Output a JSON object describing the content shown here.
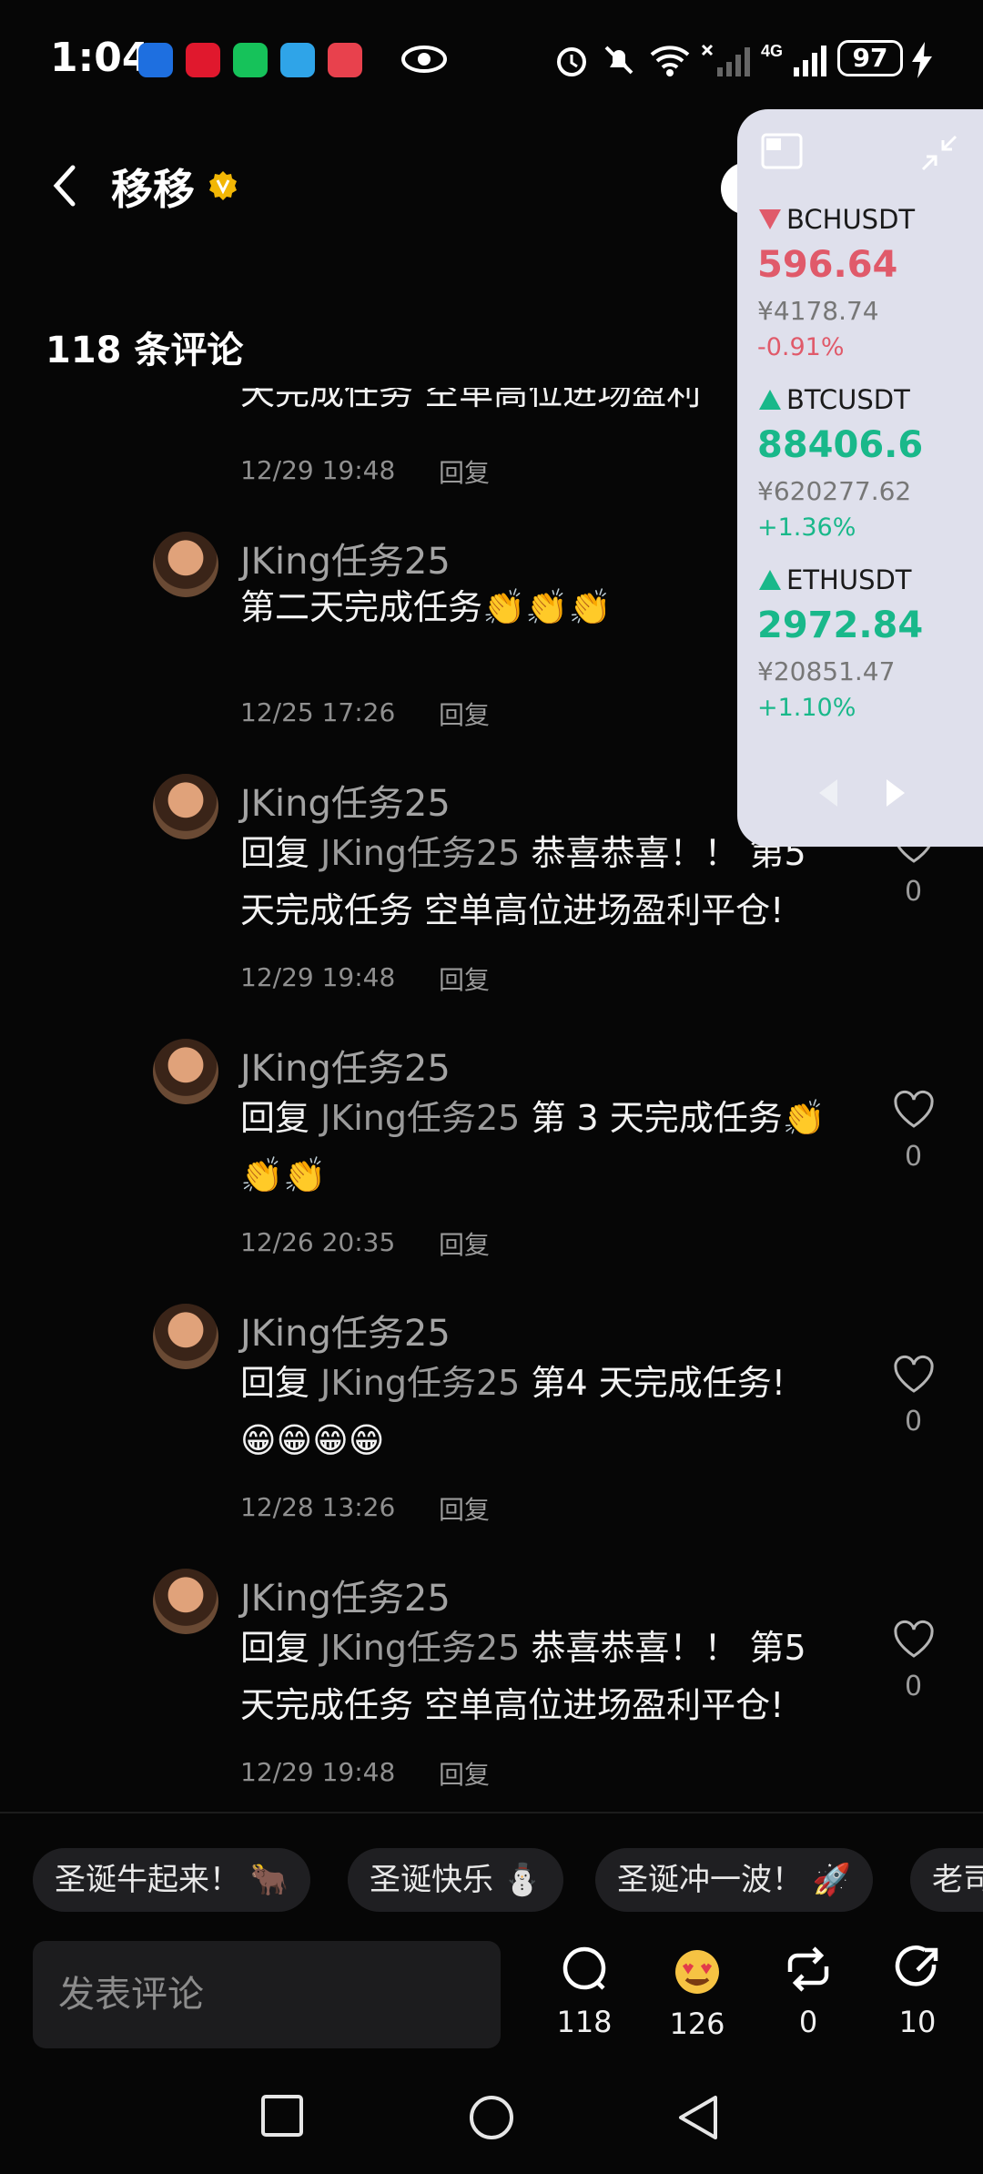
{
  "status_bar": {
    "time": "1:04",
    "battery": "97"
  },
  "header": {
    "title": "移移"
  },
  "comments_header": {
    "count_label": "118 条评论"
  },
  "partial_comment": {
    "text": "天完成任务 空单高位进场盈利",
    "date": "12/29 19:48",
    "reply": "回复"
  },
  "comments": [
    {
      "user": "JKing任务25",
      "text": "第二天完成任务👏👏👏",
      "date": "12/25 17:26",
      "reply": "回复"
    },
    {
      "user": "JKing任务25",
      "prefix": "回复",
      "ref": "JKing任务25",
      "text1": "恭喜恭喜！！ 第5",
      "text2": "天完成任务 空单高位进场盈利平仓!",
      "date": "12/29 19:48",
      "reply": "回复",
      "likes": "0"
    },
    {
      "user": "JKing任务25",
      "prefix": "回复",
      "ref": "JKing任务25",
      "text1": "第 3 天完成任务👏",
      "text2": "👏👏",
      "date": "12/26 20:35",
      "reply": "回复",
      "likes": "0"
    },
    {
      "user": "JKing任务25",
      "prefix": "回复",
      "ref": "JKing任务25",
      "text1": "第4 天完成任务!",
      "text2": "😁😁😁😁",
      "date": "12/28 13:26",
      "reply": "回复",
      "likes": "0"
    },
    {
      "user": "JKing任务25",
      "prefix": "回复",
      "ref": "JKing任务25",
      "text1": "恭喜恭喜！！ 第5",
      "text2": "天完成任务 空单高位进场盈利平仓!",
      "date": "12/29 19:48",
      "reply": "回复",
      "likes": "0"
    }
  ],
  "ticker": {
    "items": [
      {
        "symbol": "BCHUSDT",
        "price": "596.64",
        "cny": "¥4178.74",
        "change": "-0.91%",
        "direction": "down"
      },
      {
        "symbol": "BTCUSDT",
        "price": "88406.6",
        "cny": "¥620277.62",
        "change": "+1.36%",
        "direction": "up"
      },
      {
        "symbol": "ETHUSDT",
        "price": "2972.84",
        "cny": "¥20851.47",
        "change": "+1.10%",
        "direction": "up"
      }
    ]
  },
  "quick_replies": [
    "圣诞牛起来！ 🐂",
    "圣诞快乐 ⛄",
    "圣诞冲一波！ 🚀",
    "老司"
  ],
  "input": {
    "placeholder": "发表评论"
  },
  "actions": {
    "comments": "118",
    "reactions": "126",
    "reposts": "0",
    "shares": "10"
  },
  "colors": {
    "background": "#060606",
    "down": "#e05a6a",
    "up": "#19b88a",
    "badge": "#f2b705"
  }
}
